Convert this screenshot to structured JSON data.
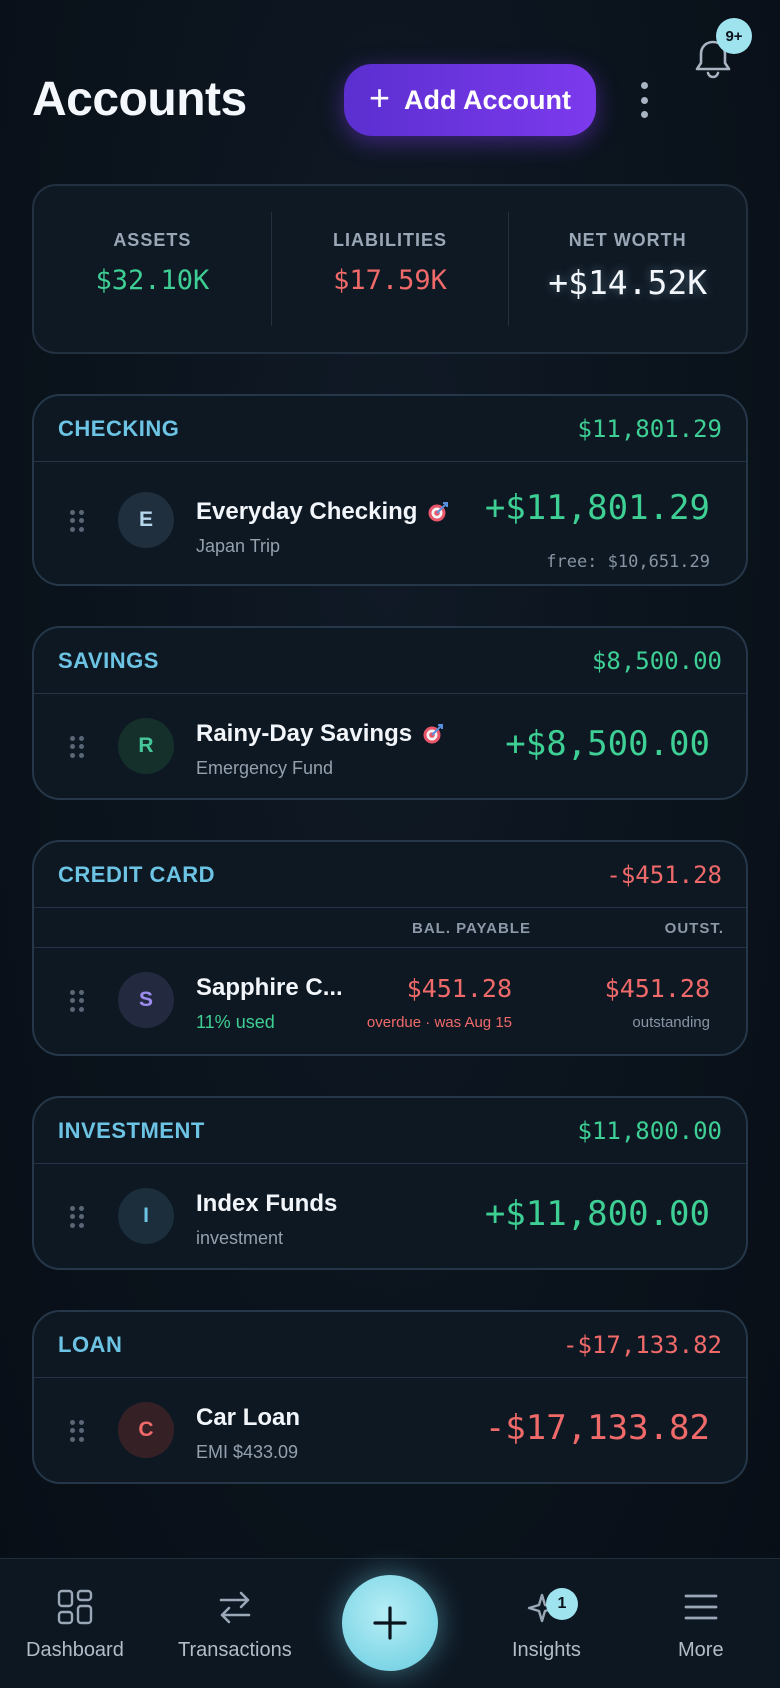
{
  "header": {
    "title": "Accounts",
    "add_button_label": "Add Account",
    "notification_badge": "9+"
  },
  "summary": {
    "assets_label": "ASSETS",
    "assets_value": "$32.10K",
    "liabilities_label": "LIABILITIES",
    "liabilities_value": "$17.59K",
    "net_worth_label": "NET WORTH",
    "net_worth_value": "+$14.52K"
  },
  "groups": {
    "checking": {
      "name": "CHECKING",
      "total": "$11,801.29",
      "account": {
        "initial": "E",
        "name": "Everyday Checking",
        "subtitle": "Japan Trip",
        "balance": "+$11,801.29",
        "free": "free: $10,651.29"
      }
    },
    "savings": {
      "name": "SAVINGS",
      "total": "$8,500.00",
      "account": {
        "initial": "R",
        "name": "Rainy-Day Savings",
        "subtitle": "Emergency Fund",
        "balance": "+$8,500.00"
      }
    },
    "credit": {
      "name": "CREDIT CARD",
      "total": "-$451.28",
      "col_payable": "BAL. PAYABLE",
      "col_outstanding": "OUTST.",
      "account": {
        "initial": "S",
        "name": "Sapphire C...",
        "subtitle": "11% used",
        "payable": "$451.28",
        "payable_note": "overdue · was Aug 15",
        "outstanding": "$451.28",
        "outstanding_note": "outstanding"
      }
    },
    "investment": {
      "name": "INVESTMENT",
      "total": "$11,800.00",
      "account": {
        "initial": "I",
        "name": "Index Funds",
        "subtitle": "investment",
        "balance": "+$11,800.00"
      }
    },
    "loan": {
      "name": "LOAN",
      "total": "-$17,133.82",
      "account": {
        "initial": "C",
        "name": "Car Loan",
        "subtitle": "EMI $433.09",
        "balance": "-$17,133.82"
      }
    }
  },
  "nav": {
    "dashboard": "Dashboard",
    "transactions": "Transactions",
    "insights": "Insights",
    "insights_badge": "1",
    "more": "More"
  },
  "icons": {
    "bell": "bell-icon",
    "kebab": "more-vertical-icon",
    "target": "target-icon",
    "drag": "drag-handle-icon",
    "dashboard": "grid-icon",
    "transactions": "swap-arrows-icon",
    "add": "plus-icon",
    "insights": "sparkle-icon",
    "more": "menu-icon"
  },
  "colors": {
    "accent": "#7c3aed",
    "positive": "#3ecf94",
    "negative": "#f06a6a",
    "group_label": "#6cc3e3",
    "fab": "#8fdcea"
  }
}
